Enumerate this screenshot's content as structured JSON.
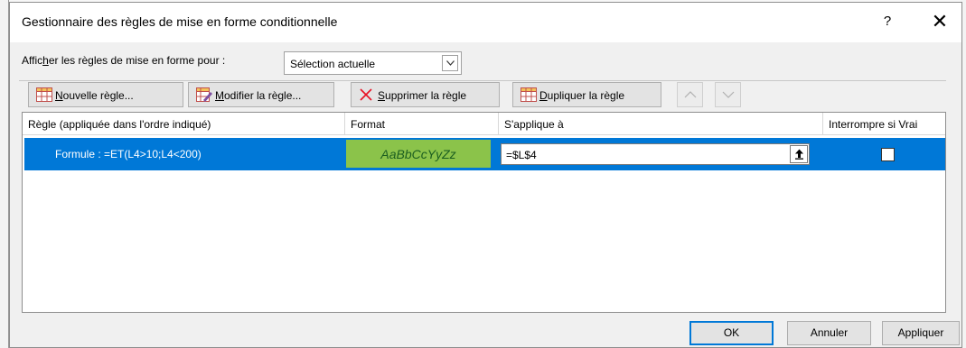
{
  "dialog": {
    "title": "Gestionnaire des règles de mise en forme conditionnelle",
    "help": "?",
    "close": "✕"
  },
  "show_rules": {
    "label_pre": "Affic",
    "label_ul": "h",
    "label_post": "er les règles de mise en forme pour :",
    "selected": "Sélection actuelle"
  },
  "toolbar": {
    "new_rule_ul": "N",
    "new_rule_rest": "ouvelle règle...",
    "edit_rule_ul": "M",
    "edit_rule_rest": "odifier la règle...",
    "delete_rule_ul": "S",
    "delete_rule_rest": "upprimer la règle",
    "duplicate_rule_ul": "D",
    "duplicate_rule_rest": "upliquer la règle"
  },
  "table": {
    "columns": [
      "Règle (appliquée dans l'ordre indiqué)",
      "Format",
      "S'applique à",
      "Interrompre si Vrai"
    ],
    "rows": [
      {
        "rule": "Formule : =ET(L4>10;L4<200)",
        "format_preview": "AaBbCcYyZz",
        "applies_to": "=$L$4",
        "stop_if_true": false
      }
    ]
  },
  "buttons": {
    "ok": "OK",
    "cancel": "Annuler",
    "apply": "Appliquer"
  },
  "colors": {
    "selection": "#0078d7",
    "format_fill": "#8bc34a",
    "delete_icon": "#e81123"
  }
}
